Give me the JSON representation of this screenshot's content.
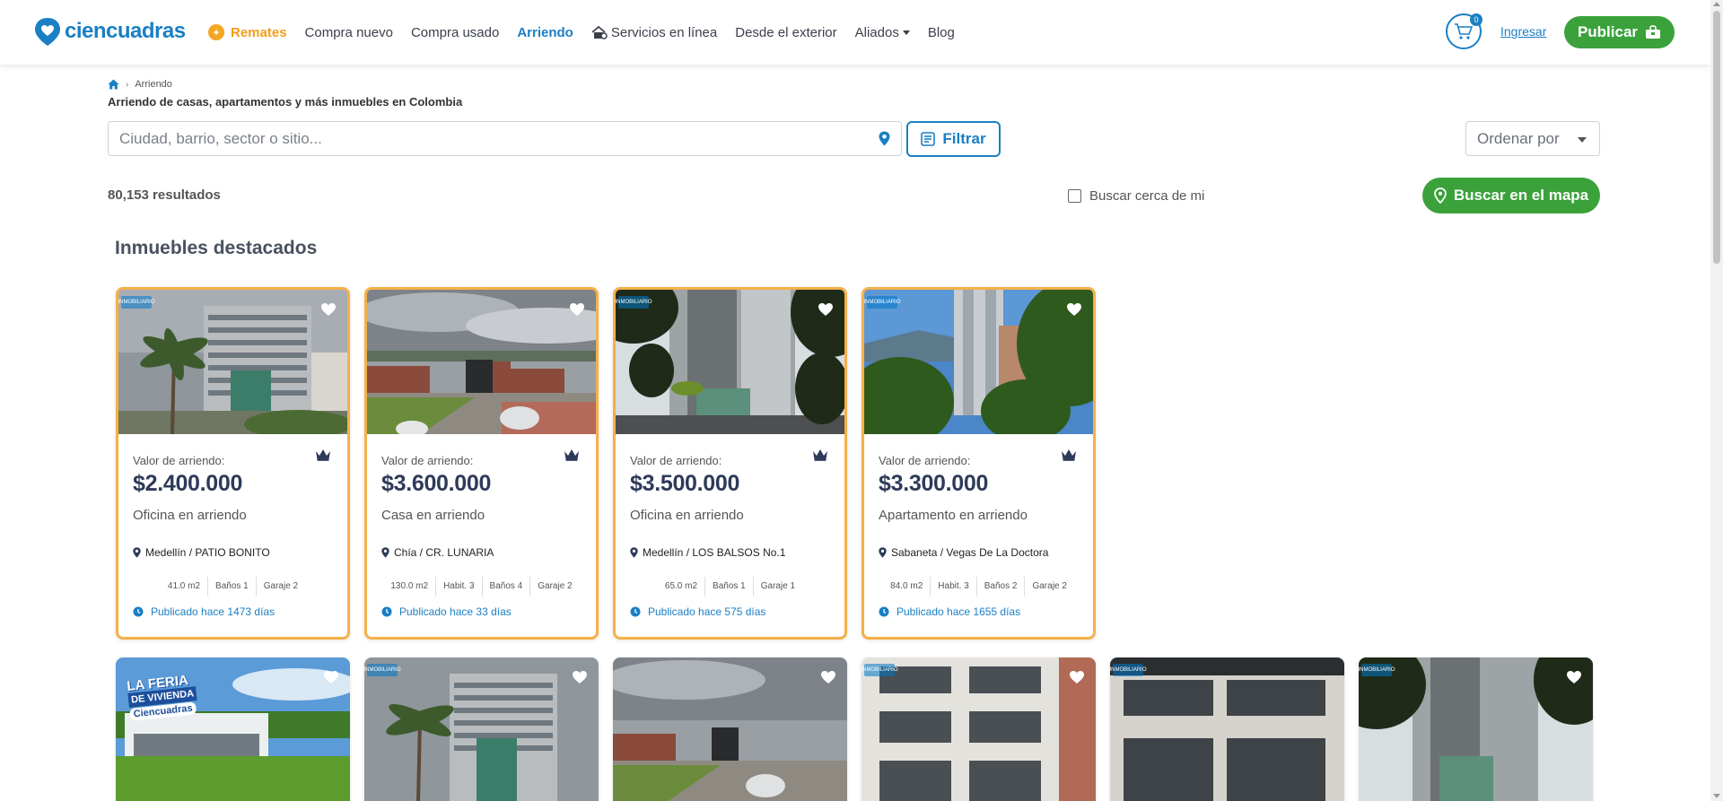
{
  "brand": {
    "name": "ciencuadras",
    "primary": "#1a7fc4",
    "accent": "#f39c1a",
    "green": "#3ba23b"
  },
  "nav": {
    "remates": "Remates",
    "items": [
      "Compra nuevo",
      "Compra usado",
      "Arriendo",
      "Servicios en línea",
      "Desde el exterior",
      "Aliados",
      "Blog"
    ],
    "active": "Arriendo"
  },
  "header": {
    "cart_count": "0",
    "login": "Ingresar",
    "publish": "Publicar"
  },
  "breadcrumb": {
    "current": "Arriendo"
  },
  "page_title": "Arriendo de casas, apartamentos y más inmuebles en Colombia",
  "search": {
    "placeholder": "Ciudad, barrio, sector o sitio...",
    "filter": "Filtrar",
    "sort": "Ordenar por"
  },
  "results": {
    "count": "80,153 resultados",
    "near_me": "Buscar cerca de mi",
    "map_button": "Buscar en el mapa"
  },
  "featured_title": "Inmuebles destacados",
  "featured": [
    {
      "price_label": "Valor de arriendo:",
      "price": "$2.400.000",
      "type": "Oficina en arriendo",
      "location": "Medellín / PATIO BONITO",
      "features": [
        "41.0 m2",
        "Baños 1",
        "Garaje 2"
      ],
      "published": "Publicado hace 1473 días",
      "badge": "INMOBILIARIO"
    },
    {
      "price_label": "Valor de arriendo:",
      "price": "$3.600.000",
      "type": "Casa en arriendo",
      "location": "Chía / CR. LUNARIA",
      "features": [
        "130.0 m2",
        "Habit. 3",
        "Baños 4",
        "Garaje 2"
      ],
      "published": "Publicado hace 33 días",
      "badge": ""
    },
    {
      "price_label": "Valor de arriendo:",
      "price": "$3.500.000",
      "type": "Oficina en arriendo",
      "location": "Medellín / LOS BALSOS No.1",
      "features": [
        "65.0 m2",
        "Baños 1",
        "Garaje 1"
      ],
      "published": "Publicado hace 575 días",
      "badge": "INMOBILIARIO"
    },
    {
      "price_label": "Valor de arriendo:",
      "price": "$3.300.000",
      "type": "Apartamento en arriendo",
      "location": "Sabaneta / Vegas De La Doctora",
      "features": [
        "84.0 m2",
        "Habit. 3",
        "Baños 2",
        "Garaje 2"
      ],
      "published": "Publicado hace 1655 días",
      "badge": "INMOBILIARIO"
    }
  ],
  "feria": {
    "line1": "LA FERIA",
    "line2": "DE VIVIENDA",
    "line3": "Ciencuadras"
  },
  "listing_badge": "INMOBILIARIO"
}
